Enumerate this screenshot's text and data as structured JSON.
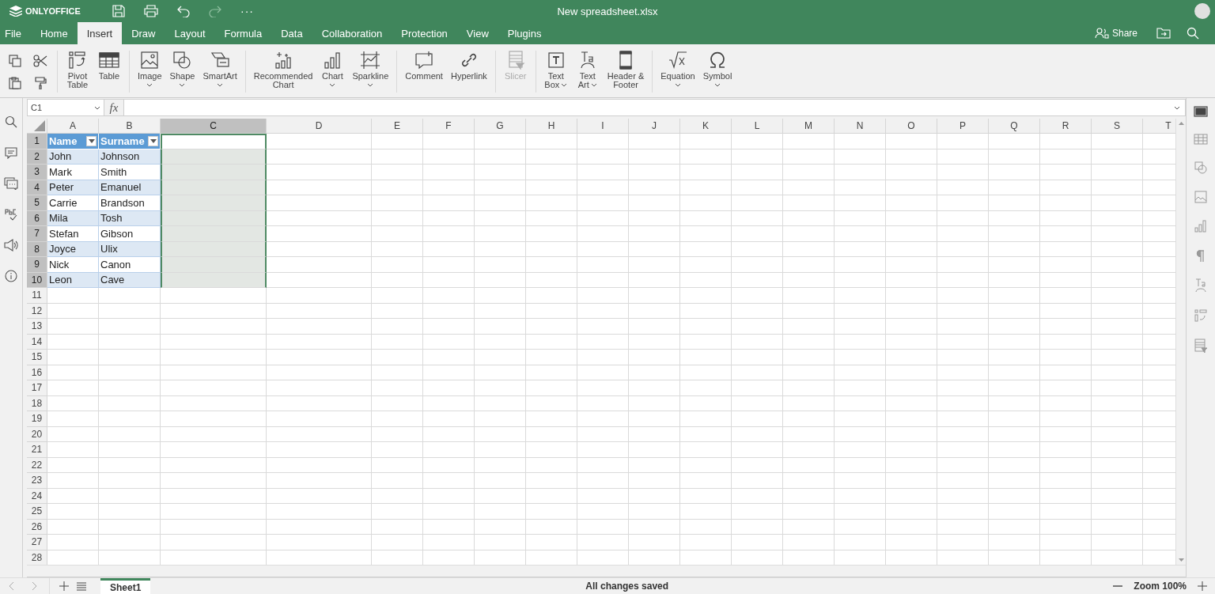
{
  "app": {
    "logo": "ONLYOFFICE",
    "title": "New spreadsheet.xlsx",
    "more": "···"
  },
  "menu_tabs": [
    {
      "label": "File",
      "selected": false
    },
    {
      "label": "Home",
      "selected": false
    },
    {
      "label": "Insert",
      "selected": true
    },
    {
      "label": "Draw",
      "selected": false
    },
    {
      "label": "Layout",
      "selected": false
    },
    {
      "label": "Formula",
      "selected": false
    },
    {
      "label": "Data",
      "selected": false
    },
    {
      "label": "Collaboration",
      "selected": false
    },
    {
      "label": "Protection",
      "selected": false
    },
    {
      "label": "View",
      "selected": false
    },
    {
      "label": "Plugins",
      "selected": false
    }
  ],
  "header_actions": {
    "share": "Share"
  },
  "toolbar": {
    "groups": [
      [
        {
          "lines": [
            "Pivot",
            "Table"
          ],
          "dropdown": false,
          "disabled": false
        },
        {
          "lines": [
            "Table"
          ],
          "dropdown": false,
          "disabled": false
        }
      ],
      [
        {
          "lines": [
            "Image"
          ],
          "dropdown": true,
          "disabled": false
        },
        {
          "lines": [
            "Shape"
          ],
          "dropdown": true,
          "disabled": false
        },
        {
          "lines": [
            "SmartArt"
          ],
          "dropdown": true,
          "disabled": false
        }
      ],
      [
        {
          "lines": [
            "Recommended",
            "Chart"
          ],
          "dropdown": false,
          "disabled": false
        },
        {
          "lines": [
            "Chart"
          ],
          "dropdown": true,
          "disabled": false
        },
        {
          "lines": [
            "Sparkline"
          ],
          "dropdown": true,
          "disabled": false
        }
      ],
      [
        {
          "lines": [
            "Comment"
          ],
          "dropdown": false,
          "disabled": false
        },
        {
          "lines": [
            "Hyperlink"
          ],
          "dropdown": false,
          "disabled": false
        }
      ],
      [
        {
          "lines": [
            "Slicer"
          ],
          "dropdown": false,
          "disabled": true
        }
      ],
      [
        {
          "lines": [
            "Text",
            "Box"
          ],
          "dropdown": true,
          "disabled": false
        },
        {
          "lines": [
            "Text",
            "Art"
          ],
          "dropdown": true,
          "disabled": false
        },
        {
          "lines": [
            "Header &",
            "Footer"
          ],
          "dropdown": false,
          "disabled": false
        }
      ],
      [
        {
          "lines": [
            "Equation"
          ],
          "dropdown": true,
          "disabled": false
        },
        {
          "lines": [
            "Symbol"
          ],
          "dropdown": true,
          "disabled": false
        }
      ]
    ]
  },
  "formula_bar": {
    "cell_ref": "C1",
    "function_label": "fx"
  },
  "sheet": {
    "columns": [
      {
        "letter": "A",
        "selected": false
      },
      {
        "letter": "B",
        "selected": false
      },
      {
        "letter": "C",
        "selected": true
      },
      {
        "letter": "D",
        "selected": false
      },
      {
        "letter": "E",
        "selected": false
      },
      {
        "letter": "F",
        "selected": false
      },
      {
        "letter": "G",
        "selected": false
      },
      {
        "letter": "H",
        "selected": false
      },
      {
        "letter": "I",
        "selected": false
      },
      {
        "letter": "J",
        "selected": false
      },
      {
        "letter": "K",
        "selected": false
      },
      {
        "letter": "L",
        "selected": false
      },
      {
        "letter": "M",
        "selected": false
      },
      {
        "letter": "N",
        "selected": false
      },
      {
        "letter": "O",
        "selected": false
      },
      {
        "letter": "P",
        "selected": false
      },
      {
        "letter": "Q",
        "selected": false
      },
      {
        "letter": "R",
        "selected": false
      },
      {
        "letter": "S",
        "selected": false
      },
      {
        "letter": "T",
        "selected": false
      }
    ],
    "rows": [
      {
        "number": "1",
        "kind": "header",
        "selected": true,
        "cells": [
          "Name",
          "Surname"
        ]
      },
      {
        "number": "2",
        "kind": "band",
        "selected": true,
        "cells": [
          "John",
          "Johnson"
        ]
      },
      {
        "number": "3",
        "kind": "row",
        "selected": true,
        "cells": [
          "Mark",
          "Smith"
        ]
      },
      {
        "number": "4",
        "kind": "band",
        "selected": true,
        "cells": [
          "Peter",
          "Emanuel"
        ]
      },
      {
        "number": "5",
        "kind": "row",
        "selected": true,
        "cells": [
          "Carrie",
          "Brandson"
        ]
      },
      {
        "number": "6",
        "kind": "band",
        "selected": true,
        "cells": [
          "Mila",
          "Tosh"
        ]
      },
      {
        "number": "7",
        "kind": "row",
        "selected": true,
        "cells": [
          "Stefan",
          "Gibson"
        ]
      },
      {
        "number": "8",
        "kind": "band",
        "selected": true,
        "cells": [
          "Joyce",
          "Ulix"
        ]
      },
      {
        "number": "9",
        "kind": "row",
        "selected": true,
        "cells": [
          "Nick",
          "Canon"
        ]
      },
      {
        "number": "10",
        "kind": "band",
        "selected": true,
        "cells": [
          "Leon",
          "Cave"
        ]
      },
      {
        "number": "11",
        "kind": "plain",
        "selected": false,
        "cells": []
      },
      {
        "number": "12",
        "kind": "plain",
        "selected": false,
        "cells": []
      },
      {
        "number": "13",
        "kind": "plain",
        "selected": false,
        "cells": []
      },
      {
        "number": "14",
        "kind": "plain",
        "selected": false,
        "cells": []
      },
      {
        "number": "15",
        "kind": "plain",
        "selected": false,
        "cells": []
      },
      {
        "number": "16",
        "kind": "plain",
        "selected": false,
        "cells": []
      },
      {
        "number": "17",
        "kind": "plain",
        "selected": false,
        "cells": []
      },
      {
        "number": "18",
        "kind": "plain",
        "selected": false,
        "cells": []
      },
      {
        "number": "19",
        "kind": "plain",
        "selected": false,
        "cells": []
      },
      {
        "number": "20",
        "kind": "plain",
        "selected": false,
        "cells": []
      },
      {
        "number": "21",
        "kind": "plain",
        "selected": false,
        "cells": []
      },
      {
        "number": "22",
        "kind": "plain",
        "selected": false,
        "cells": []
      },
      {
        "number": "23",
        "kind": "plain",
        "selected": false,
        "cells": []
      },
      {
        "number": "24",
        "kind": "plain",
        "selected": false,
        "cells": []
      },
      {
        "number": "25",
        "kind": "plain",
        "selected": false,
        "cells": []
      },
      {
        "number": "26",
        "kind": "plain",
        "selected": false,
        "cells": []
      },
      {
        "number": "27",
        "kind": "plain",
        "selected": false,
        "cells": []
      },
      {
        "number": "28",
        "kind": "plain",
        "selected": false,
        "cells": []
      }
    ]
  },
  "sheet_tabs": [
    {
      "label": "Sheet1",
      "selected": true
    }
  ],
  "status_bar": {
    "save_state": "All changes saved",
    "zoom": "Zoom 100%"
  }
}
